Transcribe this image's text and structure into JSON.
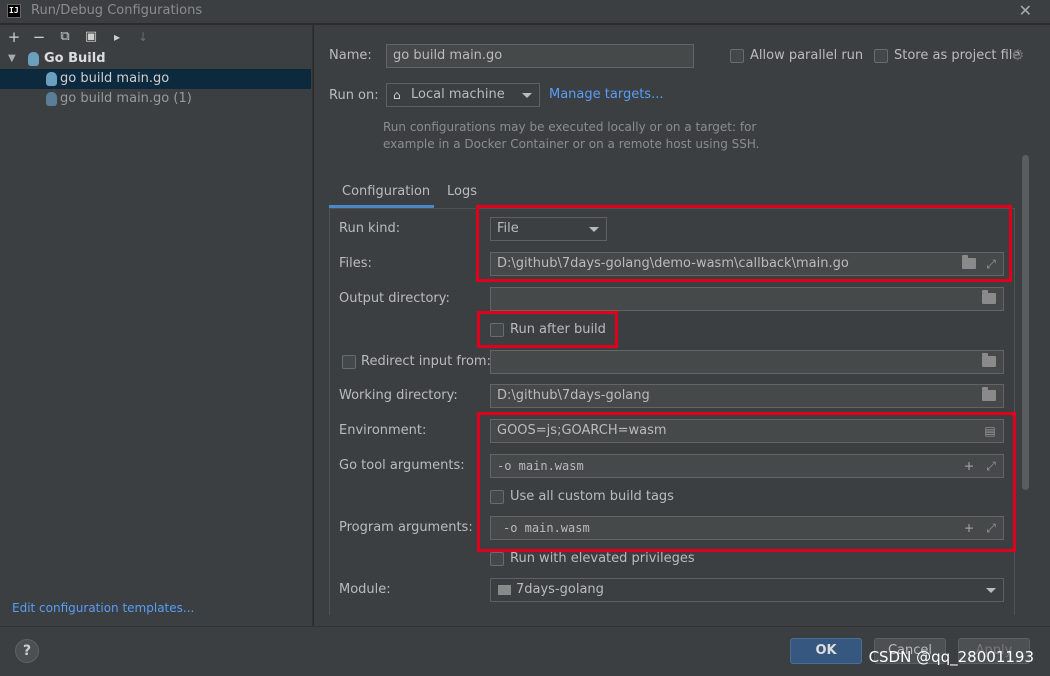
{
  "window": {
    "title": "Run/Debug Configurations",
    "app_badge": "IJ"
  },
  "toolbar": {
    "add": "+",
    "remove": "−",
    "copy": "⧉",
    "save": "▣",
    "folder": "▸",
    "sort": "↓"
  },
  "tree": {
    "group": "Go Build",
    "items": [
      {
        "label": "go build main.go"
      },
      {
        "label": "go build main.go (1)"
      }
    ],
    "edit_templates": "Edit configuration templates..."
  },
  "header": {
    "name_label": "Name:",
    "name_value": "go build main.go",
    "allow_parallel": "Allow parallel run",
    "store_project": "Store as project file",
    "run_on_label": "Run on:",
    "run_on_value": "Local machine",
    "manage_targets": "Manage targets...",
    "hint_line1": "Run configurations may be executed locally or on a target: for",
    "hint_line2": "example in a Docker Container or on a remote host using SSH."
  },
  "tabs": [
    {
      "label": "Configuration"
    },
    {
      "label": "Logs"
    }
  ],
  "form": {
    "run_kind_label": "Run kind:",
    "run_kind_value": "File",
    "files_label": "Files:",
    "files_value": "D:\\github\\7days-golang\\demo-wasm\\callback\\main.go",
    "output_dir_label": "Output directory:",
    "output_dir_value": "",
    "run_after_build": "Run after build",
    "redirect_label": "Redirect input from:",
    "redirect_value": "",
    "working_dir_label": "Working directory:",
    "working_dir_value": "D:\\github\\7days-golang",
    "env_label": "Environment:",
    "env_value": "GOOS=js;GOARCH=wasm",
    "go_tool_label": "Go tool arguments:",
    "go_tool_value": "-o main.wasm",
    "custom_tags": "Use all custom build tags",
    "program_args_label": "Program arguments:",
    "program_args_value": "-o main.wasm",
    "elevated": "Run with elevated privileges",
    "module_label": "Module:",
    "module_value": "7days-golang"
  },
  "buttons": {
    "help": "?",
    "ok": "OK",
    "cancel": "Cancel",
    "apply": "Apply"
  },
  "watermark": "CSDN @qq_28001193",
  "colors": {
    "accent": "#589df6",
    "highlight_box": "#e0001b",
    "ok_button": "#365880",
    "selected_row": "#0d293e"
  }
}
